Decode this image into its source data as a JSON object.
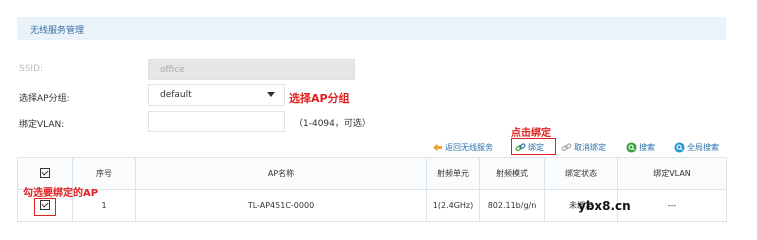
{
  "header": {
    "title": "无线服务管理"
  },
  "form": {
    "ssid_label": "SSID:",
    "ssid_value": "office",
    "group_label": "选择AP分组:",
    "group_value": "default",
    "vlan_label": "绑定VLAN:",
    "vlan_value": "",
    "vlan_hint": "（1-4094，可选）"
  },
  "annotations": {
    "select_group": "选择AP分组",
    "click_bind": "点击绑定",
    "check_ap": "勾选要绑定的AP"
  },
  "toolbar": {
    "back_label": "返回无线服务",
    "bind_label": "绑定",
    "unbind_label": "取消绑定",
    "search_label": "搜索",
    "global_search_label": "全局搜索"
  },
  "table": {
    "headers": [
      "序号",
      "AP名称",
      "射频单元",
      "射频模式",
      "绑定状态",
      "绑定VLAN"
    ],
    "rows": [
      {
        "index": "1",
        "ap_name": "TL-AP451C-0000",
        "radio_unit": "1(2.4GHz)",
        "radio_mode": "802.11b/g/n",
        "bind_status": "未绑定",
        "bind_vlan": "---"
      }
    ]
  },
  "watermark": "ybx8.cn",
  "colors": {
    "accent": "#2a6fb0",
    "annotation": "#e02020",
    "header_bg": "#eaf2fa"
  }
}
